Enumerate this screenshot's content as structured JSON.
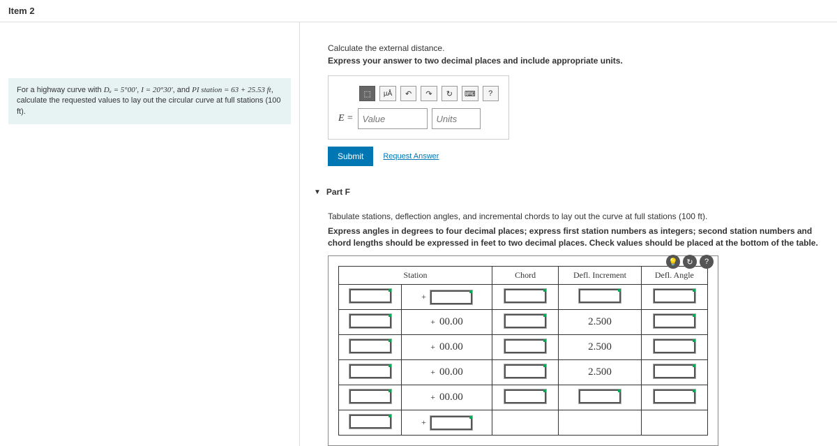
{
  "header": {
    "title": "Item 2"
  },
  "problem": {
    "prefix": "For a highway curve with ",
    "da": "Dₐ = 5°00′",
    "i": "I = 20°30′",
    "pi": "PI station = 63 + 25.53 ft",
    "suffix": ", calculate the requested values to lay out the circular curve at full stations (100 ft)."
  },
  "partE": {
    "line1": "Calculate the external distance.",
    "line2": "Express your answer to two decimal places and include appropriate units.",
    "toolbar": {
      "special": "⬚",
      "ma": "µÅ",
      "undo": "↶",
      "redo": "↷",
      "reset": "↻",
      "kbd": "⌨",
      "help": "?"
    },
    "eq_label": "E =",
    "value_ph": "Value",
    "units_ph": "Units",
    "submit": "Submit",
    "request": "Request Answer"
  },
  "partF": {
    "title": "Part F",
    "line1": "Tabulate stations, deflection angles, and incremental chords to lay out the curve at full stations (100 ft).",
    "line2": "Express angles in degrees to four decimal places; express first station numbers as integers; second station numbers and chord lengths should be expressed in feet to two decimal places. Check values should be placed at the bottom of the table.",
    "headers": {
      "station": "Station",
      "chord": "Chord",
      "defl_incr": "Defl. Increment",
      "defl_angle": "Defl. Angle"
    },
    "rows": [
      {
        "stn2": "",
        "defl_incr": ""
      },
      {
        "stn2": "00.00",
        "defl_incr": "2.500"
      },
      {
        "stn2": "00.00",
        "defl_incr": "2.500"
      },
      {
        "stn2": "00.00",
        "defl_incr": "2.500"
      },
      {
        "stn2": "00.00",
        "defl_incr": ""
      },
      {
        "stn2": "",
        "defl_incr": ""
      }
    ],
    "tools": {
      "hint": "💡",
      "redo": "↻",
      "help": "?"
    }
  }
}
